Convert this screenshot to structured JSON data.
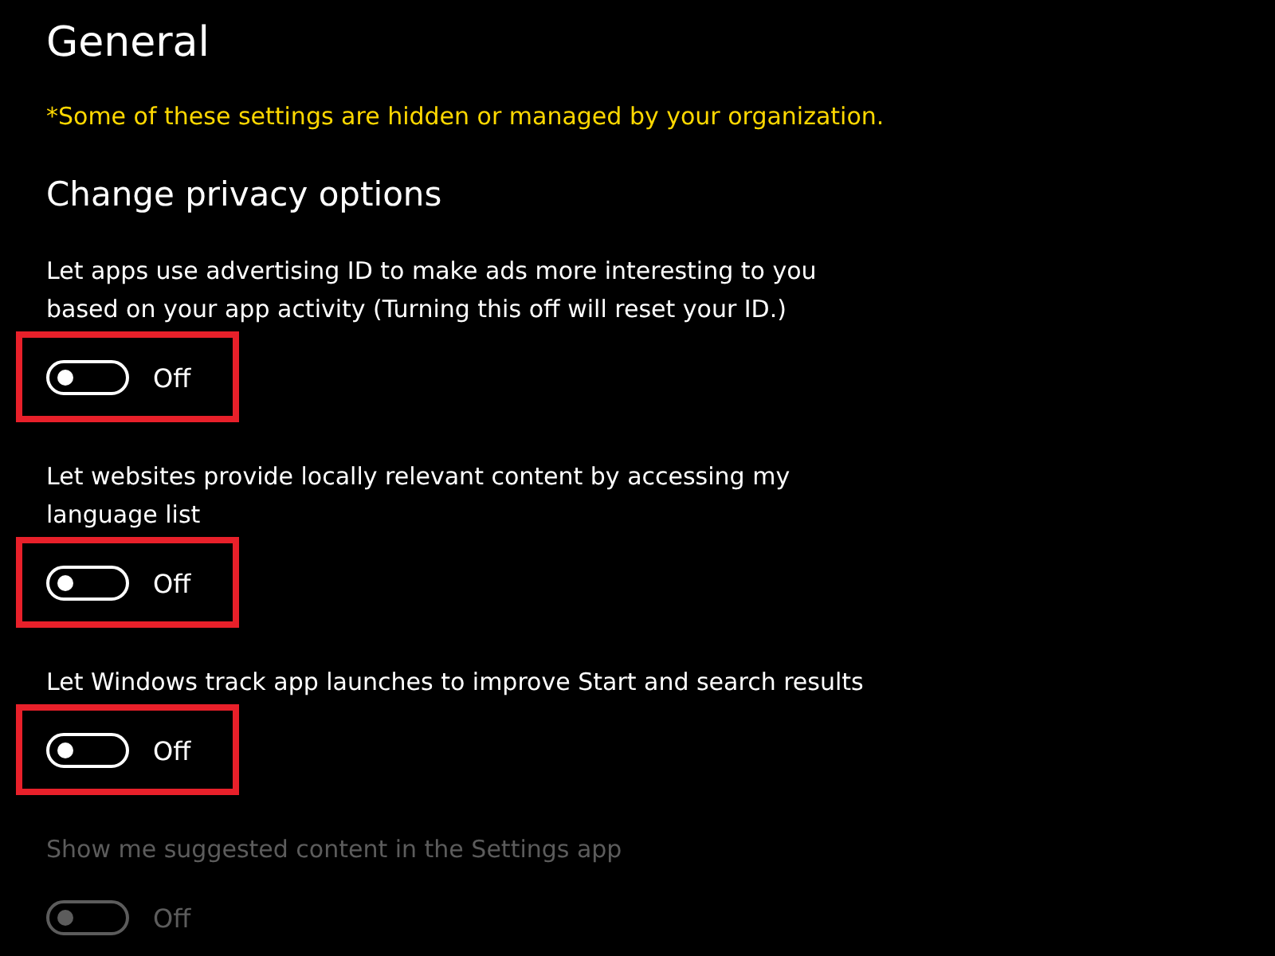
{
  "page": {
    "title": "General",
    "notice": "*Some of these settings are hidden or managed by your organization.",
    "section_title": "Change privacy options"
  },
  "settings": [
    {
      "label": "Let apps use advertising ID to make ads more interesting to you based on your app activity (Turning this off will reset your ID.)",
      "on": false,
      "state_text": "Off",
      "disabled": false,
      "highlighted": true
    },
    {
      "label": "Let websites provide locally relevant content by accessing my language list",
      "on": false,
      "state_text": "Off",
      "disabled": false,
      "highlighted": true
    },
    {
      "label": "Let Windows track app launches to improve Start and search results",
      "on": false,
      "state_text": "Off",
      "disabled": false,
      "highlighted": true
    },
    {
      "label": "Show me suggested content in the Settings app",
      "on": false,
      "state_text": "Off",
      "disabled": true,
      "highlighted": false
    }
  ]
}
